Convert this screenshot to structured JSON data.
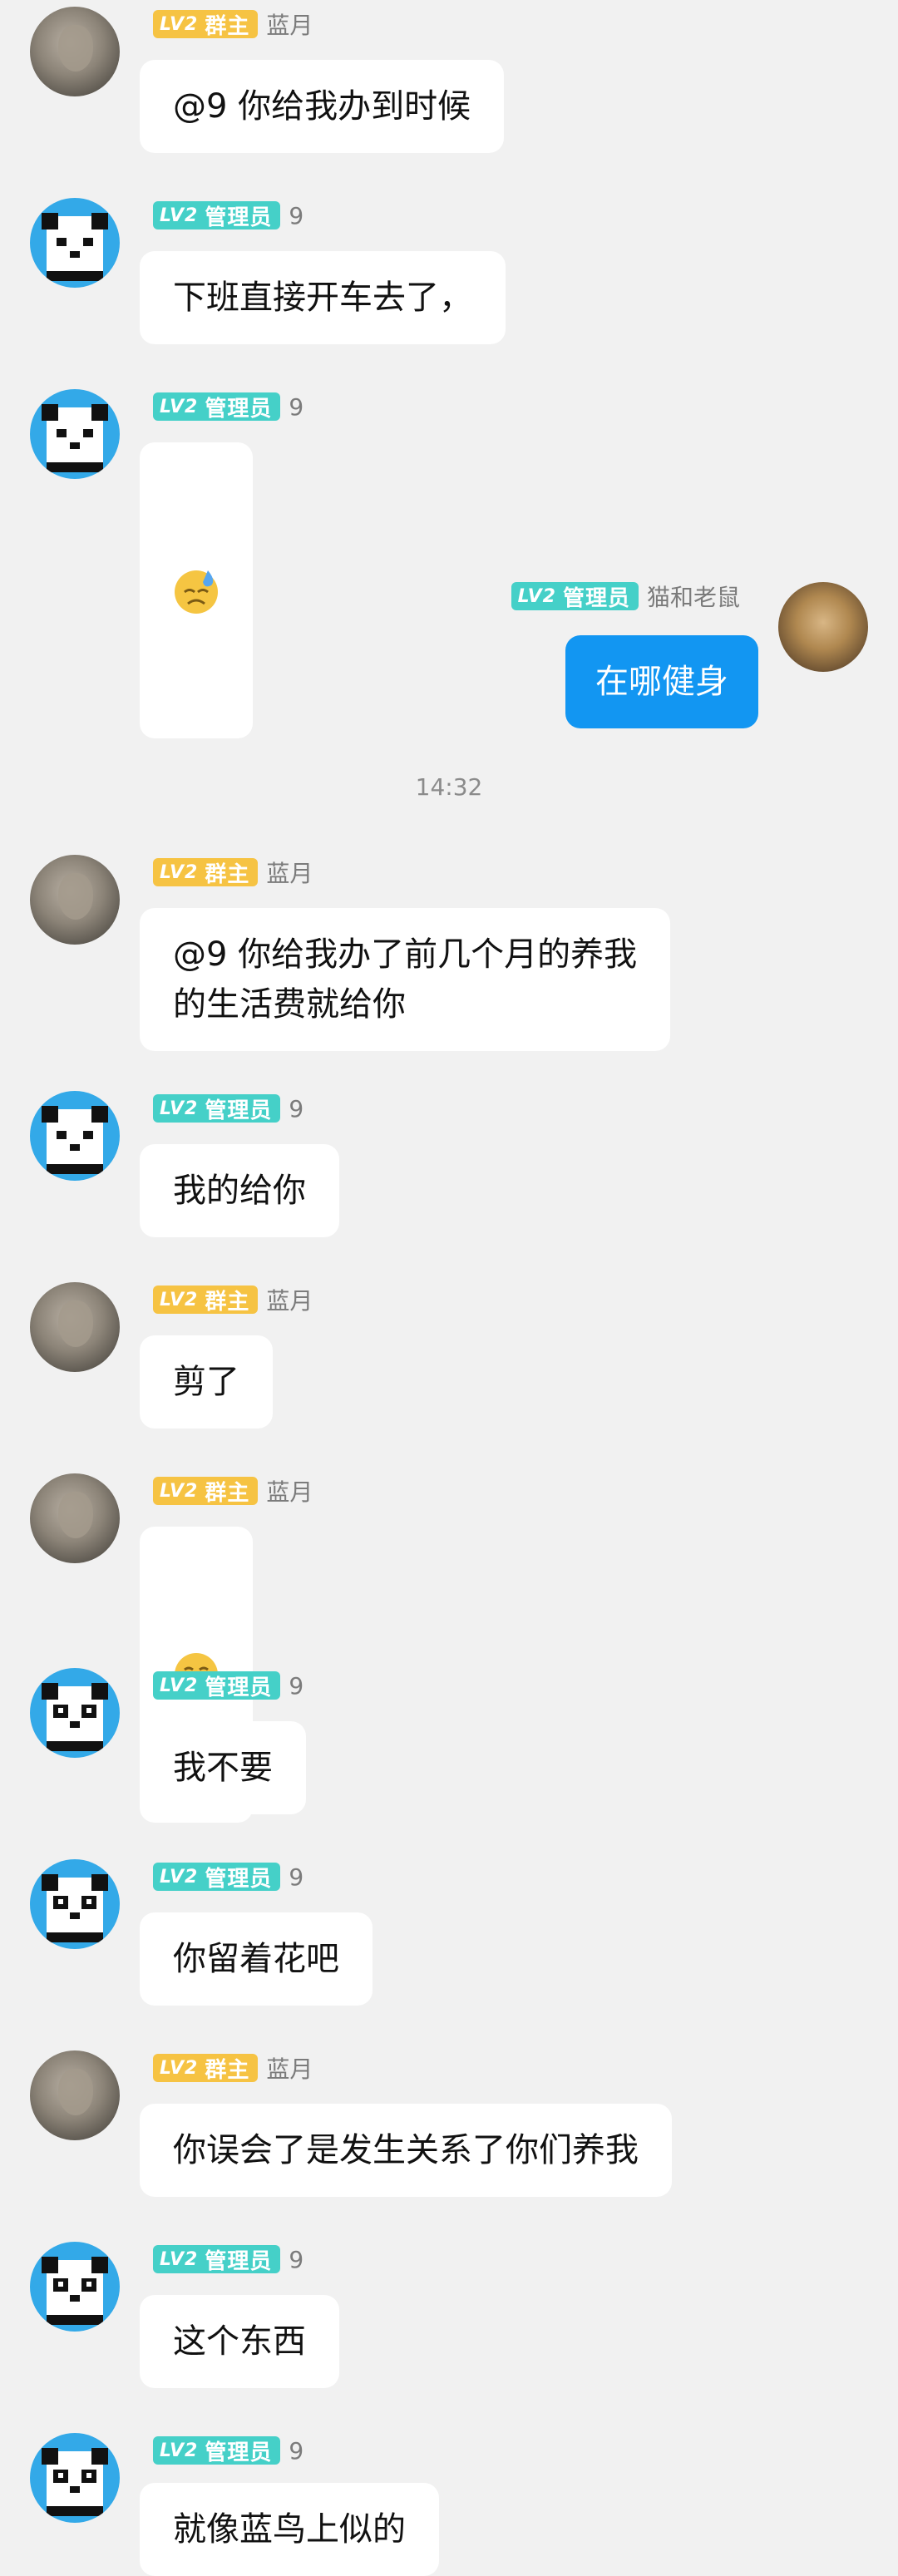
{
  "badges": {
    "level": "LV2",
    "owner": "群主",
    "admin": "管理员"
  },
  "messages": [
    {
      "name": "蓝月",
      "text": "@9 你给我办到时候"
    },
    {
      "name": "9",
      "text": "下班直接开车去了，"
    },
    {
      "name": "9",
      "emoji": "sweat-smile"
    },
    {
      "name": "猫和老鼠",
      "text": "在哪健身"
    },
    {
      "name": "蓝月",
      "text": "@9 你给我办了前几个月的养我\n的生活费就给你"
    },
    {
      "name": "9",
      "text": "我的给你"
    },
    {
      "name": "蓝月",
      "text": "剪了"
    },
    {
      "name": "蓝月",
      "emoji": "shushing-face"
    },
    {
      "name": "9",
      "text": "我不要"
    },
    {
      "name": "9",
      "text": "你留着花吧"
    },
    {
      "name": "蓝月",
      "text": "你误会了是发生关系了你们养我"
    },
    {
      "name": "9",
      "text": "这个东西"
    },
    {
      "name": "9",
      "text": "就像蓝鸟上似的"
    }
  ],
  "timestamp": "14:32",
  "colors": {
    "owner_badge": "#f6c343",
    "admin_badge": "#45d0c8",
    "outgoing_bubble": "#1296f2",
    "panda_bg": "#33a9e8"
  }
}
